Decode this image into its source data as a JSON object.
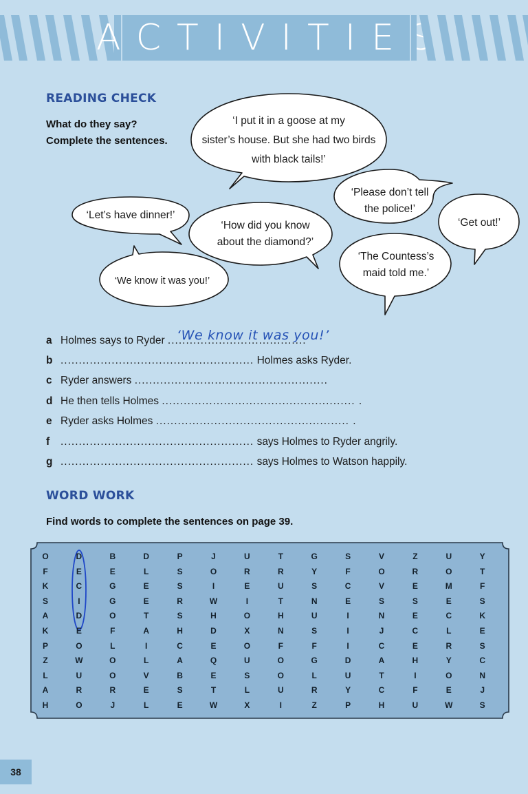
{
  "banner": {
    "title": "ACTIVITIES"
  },
  "reading_check": {
    "heading": "READING CHECK",
    "instruction_line1": "What do they say?",
    "instruction_line2": "Complete the sentences.",
    "bubbles": [
      {
        "lines": [
          "‘I put it in a goose at my",
          "sister’s house. But she had two birds",
          "with black tails!’"
        ]
      },
      {
        "lines": [
          "‘Please don’t tell",
          "the police!’"
        ]
      },
      {
        "lines": [
          "‘Get out!’"
        ]
      },
      {
        "lines": [
          "‘Let’s have dinner!’"
        ]
      },
      {
        "lines": [
          "‘How did you know",
          "about the diamond?’"
        ]
      },
      {
        "lines": [
          "‘The Countess’s",
          "maid told me.’"
        ]
      },
      {
        "lines": [
          "‘We know it was you!’"
        ]
      }
    ],
    "exercises": [
      {
        "letter": "a",
        "before": "Holmes says to Ryder",
        "dots": "......................................",
        "after": ""
      },
      {
        "letter": "b",
        "before": "",
        "dots": ".....................................................",
        "after": "Holmes asks Ryder."
      },
      {
        "letter": "c",
        "before": "Ryder answers",
        "dots": ".....................................................",
        "after": ""
      },
      {
        "letter": "d",
        "before": "He then tells Holmes",
        "dots": "..................................................... .",
        "after": ""
      },
      {
        "letter": "e",
        "before": "Ryder asks Holmes",
        "dots": "..................................................... .",
        "after": ""
      },
      {
        "letter": "f",
        "before": "",
        "dots": ".....................................................",
        "after": "says Holmes to Ryder angrily."
      },
      {
        "letter": "g",
        "before": "",
        "dots": ".....................................................",
        "after": "says Holmes to Watson happily."
      }
    ],
    "handwritten_answer": "‘We know it was you!’"
  },
  "word_work": {
    "heading": "WORD WORK",
    "instruction": "Find words to complete the sentences on page 39.",
    "grid": [
      [
        "O",
        "D",
        "B",
        "D",
        "P",
        "J",
        "U",
        "T",
        "G",
        "S",
        "V",
        "Z",
        "U",
        "Y"
      ],
      [
        "F",
        "E",
        "E",
        "L",
        "S",
        "O",
        "R",
        "R",
        "Y",
        "F",
        "O",
        "R",
        "O",
        "T"
      ],
      [
        "K",
        "C",
        "G",
        "E",
        "S",
        "I",
        "E",
        "U",
        "S",
        "C",
        "V",
        "E",
        "M",
        "F"
      ],
      [
        "S",
        "I",
        "G",
        "E",
        "R",
        "W",
        "I",
        "T",
        "N",
        "E",
        "S",
        "S",
        "E",
        "S"
      ],
      [
        "A",
        "D",
        "O",
        "T",
        "S",
        "H",
        "O",
        "H",
        "U",
        "I",
        "N",
        "E",
        "C",
        "K"
      ],
      [
        "K",
        "E",
        "F",
        "A",
        "H",
        "D",
        "X",
        "N",
        "S",
        "I",
        "J",
        "C",
        "L",
        "E"
      ],
      [
        "P",
        "O",
        "L",
        "I",
        "C",
        "E",
        "O",
        "F",
        "F",
        "I",
        "C",
        "E",
        "R",
        "S"
      ],
      [
        "Z",
        "W",
        "O",
        "L",
        "A",
        "Q",
        "U",
        "O",
        "G",
        "D",
        "A",
        "H",
        "Y",
        "C"
      ],
      [
        "L",
        "U",
        "O",
        "V",
        "B",
        "E",
        "S",
        "O",
        "L",
        "U",
        "T",
        "I",
        "O",
        "N"
      ],
      [
        "A",
        "R",
        "R",
        "E",
        "S",
        "T",
        "L",
        "U",
        "R",
        "Y",
        "C",
        "F",
        "E",
        "J"
      ],
      [
        "H",
        "O",
        "J",
        "L",
        "E",
        "W",
        "X",
        "I",
        "Z",
        "P",
        "H",
        "U",
        "W",
        "S"
      ]
    ]
  },
  "page_number": "38",
  "colors": {
    "page_bg": "#c4ddee",
    "banner_blue": "#8fbbd9",
    "heading_blue": "#2b4f9a",
    "grid_bg": "#8fb5d4",
    "pen_blue": "#2451b5"
  }
}
